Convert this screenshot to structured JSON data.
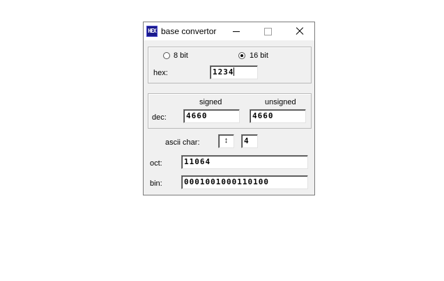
{
  "window": {
    "title": "base convertor",
    "icon_text": "HEX",
    "icon_name": "hex-app-icon"
  },
  "mode": {
    "option_8bit": "8 bit",
    "option_16bit": "16 bit",
    "selected": "16 bit"
  },
  "hex": {
    "label": "hex:",
    "value": "1234"
  },
  "dec": {
    "label": "dec:",
    "signed_header": "signed",
    "unsigned_header": "unsigned",
    "signed_value": "4660",
    "unsigned_value": "4660"
  },
  "ascii": {
    "label": "ascii char:",
    "spinner_glyph": "↕",
    "value": "4"
  },
  "oct": {
    "label": "oct:",
    "value": "11064"
  },
  "bin": {
    "label": "bin:",
    "value": "0001001000110100"
  }
}
